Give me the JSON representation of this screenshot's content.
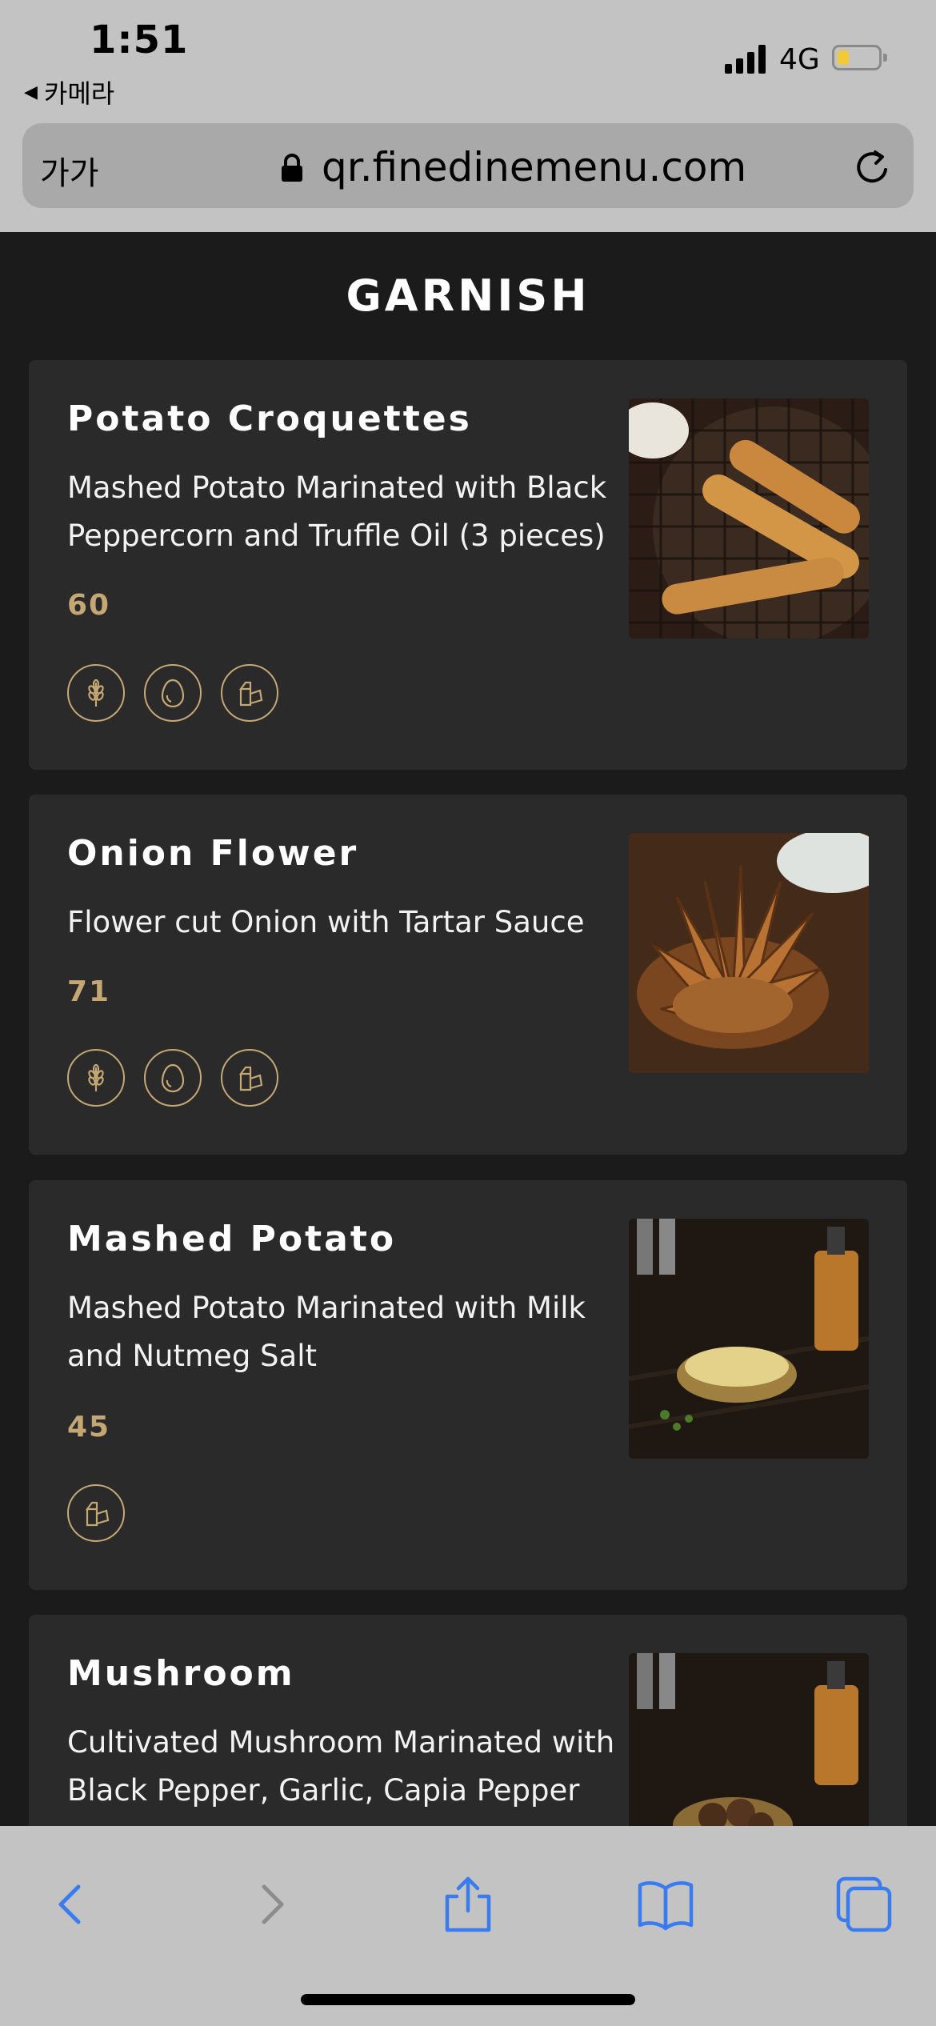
{
  "status": {
    "time": "1:51",
    "back_app": "카메라",
    "network": "4G"
  },
  "browser": {
    "text_size": "가가",
    "url": "qr.finedinemenu.com"
  },
  "section_title": "GARNISH",
  "items": [
    {
      "name": "Potato Croquettes",
      "description": "Mashed Potato Marinated with Black Peppercorn and Truffle Oil (3 pieces)",
      "price": "60",
      "allergens": [
        "gluten-icon",
        "egg-icon",
        "milk-icon"
      ]
    },
    {
      "name": "Onion Flower",
      "description": "Flower cut Onion with Tartar Sauce",
      "price": "71",
      "allergens": [
        "gluten-icon",
        "egg-icon",
        "milk-icon"
      ]
    },
    {
      "name": "Mashed Potato",
      "description": "Mashed Potato Marinated with Milk and Nutmeg Salt",
      "price": "45",
      "allergens": [
        "milk-icon"
      ]
    },
    {
      "name": "Mushroom",
      "description": "Cultivated Mushroom Marinated with Black Pepper, Garlic, Capia Pepper",
      "price": "",
      "allergens": []
    }
  ],
  "colors": {
    "accent": "#c4a773",
    "card_bg": "#2a2a2b",
    "page_bg": "#1b1b1b",
    "toolbar_icon": "#3a7cf0"
  }
}
